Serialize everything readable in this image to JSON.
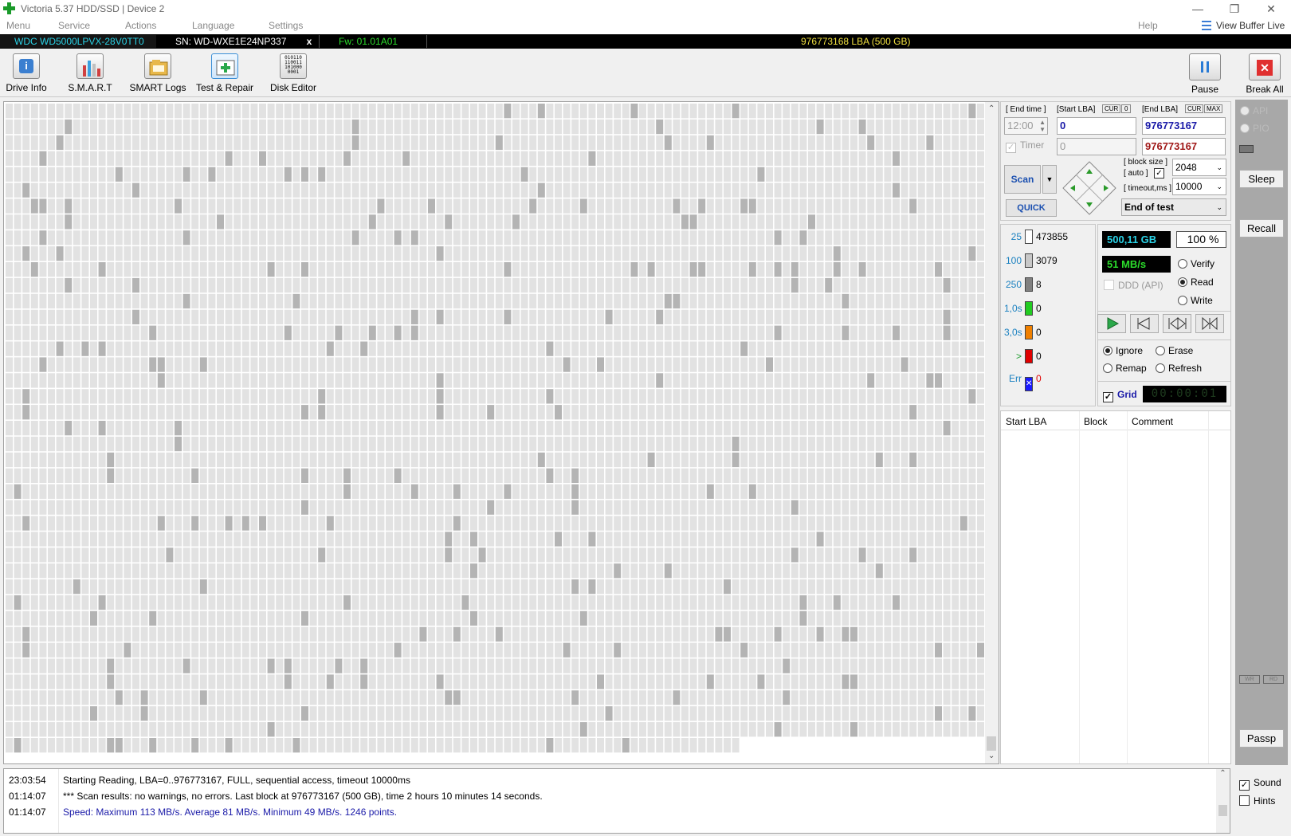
{
  "window": {
    "title": "Victoria 5.37 HDD/SSD | Device 2"
  },
  "menu": {
    "items": [
      "Menu",
      "Service",
      "Actions",
      "Language",
      "Settings"
    ],
    "help": "Help",
    "view_buffer": "View Buffer Live"
  },
  "drive": {
    "model": "WDC WD5000LPVX-28V0TT0",
    "serial": "SN: WD-WXE1E24NP337",
    "close": "x",
    "firmware": "Fw: 01.01A01",
    "lba": "976773168 LBA (500 GB)"
  },
  "toolbar": {
    "items": [
      "Drive Info",
      "S.M.A.R.T",
      "SMART Logs",
      "Test & Repair",
      "Disk Editor"
    ],
    "pause": "Pause",
    "break_all": "Break All"
  },
  "scan": {
    "end_time_label": "[ End time ]",
    "start_lba_label": "[Start LBA]",
    "end_lba_label": "[End LBA]",
    "cur_label": "CUR",
    "zero_label": "0",
    "max_label": "MAX",
    "end_time": "12:00",
    "timer_label": "Timer",
    "timer_value": "0",
    "start_lba": "0",
    "end_lba": "976773167",
    "end_lba_2": "976773167",
    "scan_button": "Scan",
    "quick_button": "QUICK",
    "block_size_label": "[ block size ]",
    "auto_label": "[ auto ]",
    "timeout_label": "[ timeout,ms ]",
    "block_size": "2048",
    "timeout": "10000",
    "end_of_test": "End of test"
  },
  "stats": [
    {
      "label": "25",
      "count": "473855",
      "color": "#ffffff"
    },
    {
      "label": "100",
      "count": "3079",
      "color": "#c8c8c8"
    },
    {
      "label": "250",
      "count": "8",
      "color": "#808080"
    },
    {
      "label": "1,0s",
      "count": "0",
      "color": "#22cc22"
    },
    {
      "label": "3,0s",
      "count": "0",
      "color": "#f08000"
    },
    {
      "label": ">",
      "count": "0",
      "color": "#e00000"
    },
    {
      "label": "Err",
      "count": "0",
      "color": "#1a1aff"
    }
  ],
  "progress": {
    "size": "500,11 GB",
    "percent": "100",
    "percent_sign": "%",
    "speed": "51 MB/s",
    "ddd": "DDD (API)"
  },
  "modes": {
    "verify": "Verify",
    "read": "Read",
    "write": "Write"
  },
  "actions": {
    "ignore": "Ignore",
    "erase": "Erase",
    "remap": "Remap",
    "refresh": "Refresh"
  },
  "grid": {
    "label": "Grid",
    "timer": "00:00:01"
  },
  "table": {
    "headers": [
      "Start LBA",
      "Block",
      "Comment"
    ]
  },
  "side": {
    "api": "API",
    "pio": "PIO",
    "sleep": "Sleep",
    "recall": "Recall",
    "wr": "WR",
    "rd": "RD",
    "passp": "Passp",
    "sound": "Sound",
    "hints": "Hints"
  },
  "log": [
    {
      "time": "23:03:54",
      "text": "Starting Reading, LBA=0..976773167, FULL, sequential access, timeout 10000ms",
      "color": "#000000"
    },
    {
      "time": "01:14:07",
      "text": "*** Scan results: no warnings, no errors. Last block at 976773167 (500 GB), time 2 hours 10 minutes 14 seconds.",
      "color": "#000000"
    },
    {
      "time": "01:14:07",
      "text": "Speed: Maximum 113 MB/s. Average 81 MB/s. Minimum 49 MB/s. 1246 points.",
      "color": "#1a1aa8"
    }
  ]
}
